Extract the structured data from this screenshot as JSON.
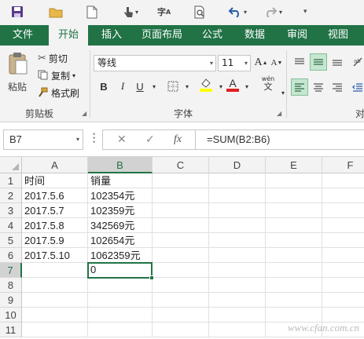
{
  "quick_access": {
    "icons": [
      "save-icon",
      "open-folder-icon",
      "new-file-icon",
      "touch-mode-icon",
      "spelling-icon",
      "print-preview-icon",
      "undo-icon",
      "redo-icon",
      "customize-icon"
    ]
  },
  "tabs": [
    {
      "label": "文件"
    },
    {
      "label": "开始"
    },
    {
      "label": "插入"
    },
    {
      "label": "页面布局"
    },
    {
      "label": "公式"
    },
    {
      "label": "数据"
    },
    {
      "label": "审阅"
    },
    {
      "label": "视图"
    }
  ],
  "active_tab": "开始",
  "clipboard": {
    "paste_label": "粘贴",
    "cut_label": "剪切",
    "copy_label": "复制",
    "format_painter_label": "格式刷",
    "group_label": "剪贴板"
  },
  "font": {
    "font_name": "等线",
    "font_size": "11",
    "bold": "B",
    "italic": "I",
    "underline": "U",
    "group_label": "字体",
    "wen_label": "wén",
    "wen_char": "文"
  },
  "alignment": {
    "group_label_partial": "对"
  },
  "formula_bar": {
    "name_box": "B7",
    "fx_label": "fx",
    "formula": "=SUM(B2:B6)"
  },
  "grid": {
    "columns": [
      "A",
      "B",
      "C",
      "D",
      "E",
      "F"
    ],
    "rows": [
      "1",
      "2",
      "3",
      "4",
      "5",
      "6",
      "7",
      "8",
      "9",
      "10",
      "11"
    ],
    "cells": {
      "A1": "时间",
      "B1": "销量",
      "A2": "2017.5.6",
      "B2": "102354元",
      "A3": "2017.5.7",
      "B3": "102359元",
      "A4": "2017.5.8",
      "B4": "342569元",
      "A5": "2017.5.9",
      "B5": "102654元",
      "A6": "2017.5.10",
      "B6": "1062359元",
      "B7": "0"
    },
    "active_cell": "B7"
  },
  "watermark": "www.cfan.com.cn",
  "colors": {
    "accent": "#217346",
    "ribbon_bg": "#f3f3f3",
    "selection_fill": "#c5e6d0"
  }
}
